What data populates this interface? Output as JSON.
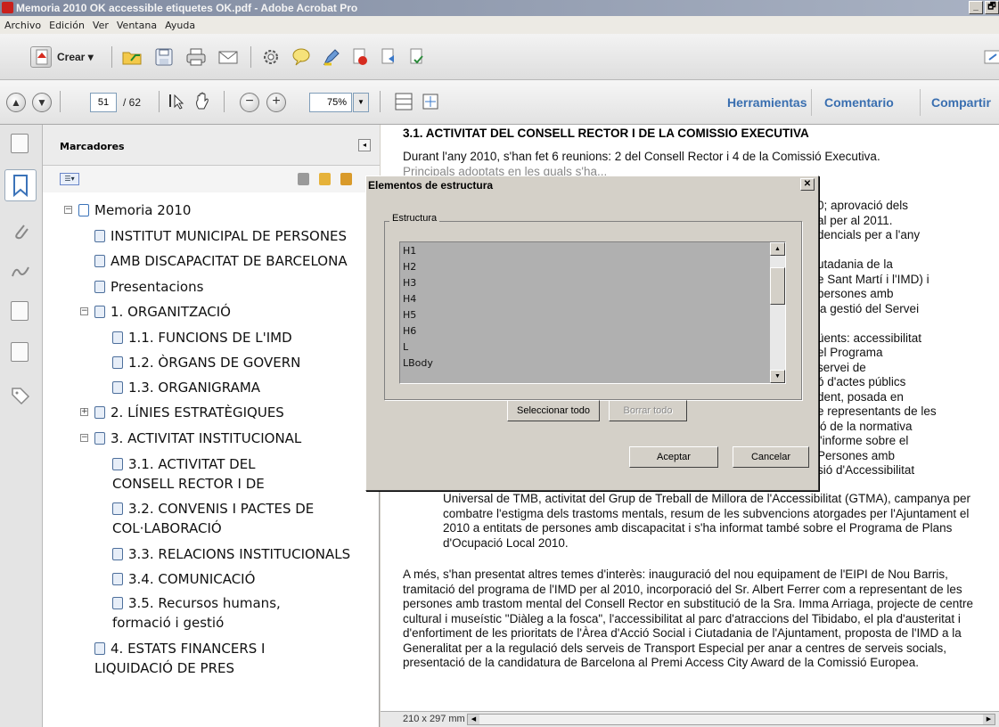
{
  "window": {
    "title": "Memoria 2010 OK accessible etiquetes OK.pdf - Adobe Acrobat Pro",
    "min_label": "_",
    "restore_label": "🗗"
  },
  "menu": [
    "Archivo",
    "Edición",
    "Ver",
    "Ventana",
    "Ayuda"
  ],
  "toolbar": {
    "create_label": "Crear ▾"
  },
  "nav": {
    "page_current": "51",
    "page_total": "/ 62",
    "zoom": "75%",
    "zoom_arrow": "▼",
    "prev_symbol": "▲",
    "next_symbol": "▼",
    "zoom_out_symbol": "−",
    "zoom_in_symbol": "+",
    "links": [
      "Herramientas",
      "Comentario",
      "Compartir"
    ]
  },
  "bookmarks": {
    "header": "Marcadores",
    "collapse_symbol": "◂",
    "options_symbol": "☰▾",
    "items": [
      {
        "label": "Memoria 2010",
        "toggle": "−"
      },
      {
        "label": "INSTITUT MUNICIPAL DE PERSONES",
        "toggle": ""
      },
      {
        "label": "AMB DISCAPACITAT DE BARCELONA",
        "toggle": ""
      },
      {
        "label": "Presentacions",
        "toggle": ""
      },
      {
        "label": "1. ORGANITZACIÓ",
        "toggle": "−"
      },
      {
        "label": "1.1. FUNCIONS DE L'IMD",
        "toggle": ""
      },
      {
        "label": "1.2. ÒRGANS DE GOVERN",
        "toggle": ""
      },
      {
        "label": "1.3. ORGANIGRAMA",
        "toggle": ""
      },
      {
        "label": "2. LÍNIES ESTRATÈGIQUES",
        "toggle": "+"
      },
      {
        "label": "3. ACTIVITAT INSTITUCIONAL",
        "toggle": "−"
      },
      {
        "label": "3.1.  ACTIVITAT DEL CONSELL RECTOR I DE",
        "toggle": ""
      },
      {
        "label": "3.2. CONVENIS I PACTES DE COL·LABORACIÓ",
        "toggle": ""
      },
      {
        "label": "3.3. RELACIONS INSTITUCIONALS",
        "toggle": ""
      },
      {
        "label": "3.4. COMUNICACIÓ",
        "toggle": ""
      },
      {
        "label": "3.5. Recursos humans, formació i gestió",
        "toggle": ""
      },
      {
        "label": "4. ESTATS FINANCERS I LIQUIDACIÓ DE PRES",
        "toggle": ""
      }
    ]
  },
  "document": {
    "heading": "3.1.  ACTIVITAT DEL CONSELL RECTOR I DE LA COMISSIO EXECUTIVA",
    "para1": "Durant l'any 2010, s'han fet 6 reunions: 2 del Consell Rector i 4 de la Comissió Executiva.",
    "para1_cut": "Principals adoptats en les quals s'ha...",
    "right_lines": [
      "0; aprovació dels",
      "al per al 2011.",
      "dencials per a l'any",
      "",
      "utadania de la",
      "e Sant Martí i l'IMD) i",
      "persones amb",
      "la gestió del Servei",
      "",
      "üents: accessibilitat",
      "el Programa",
      "servei de",
      "ó d'actes públics",
      "dent, posada en",
      "e representants de les",
      "ió de la normativa",
      "l'informe sobre el",
      "Persones amb",
      "sió d'Accessibilitat"
    ],
    "para_indented": "Universal de TMB, activitat del Grup de Treball de Millora de l'Accessibilitat (GTMA), campanya per combatre l'estigma dels trastoms mentals, resum de les subvencions atorgades per l'Ajuntament el 2010 a entitats de persones amb discapacitat i s'ha informat també sobre el Programa de Plans d'Ocupació Local 2010.",
    "para2": "A més, s'han presentat altres temes d'interès: inauguració del nou equipament de l'EIPI de Nou Barris, tramitació del programa de l'IMD per al 2010, incorporació del Sr. Albert Ferrer com a representant de les persones amb trastom mental del Consell Rector en substitució de la Sra. Imma Arriaga, projecte de centre cultural i museístic \"Diàleg a la fosca\", l'accessibilitat al parc d'atraccions del Tibidabo, el pla d'austeritat i d'enfortiment de les prioritats de l'Àrea d'Acció Social i Ciutadania de l'Ajuntament, proposta de l'IMD a la Generalitat per a la regulació dels serveis de Transport Especial per anar a centres de serveis socials, presentació de la candidatura de Barcelona al Premi Access City Award de la Comissió Europea."
  },
  "status": {
    "page_size": "210 x 297 mm",
    "scroll_left": "◀",
    "scroll_right": "▶"
  },
  "dialog": {
    "title": "Elementos de estructura",
    "close_label": "✕",
    "group_label": "Estructura",
    "list_items": [
      "H1",
      "H2",
      "H3",
      "H4",
      "H5",
      "H6",
      "L",
      "LBody"
    ],
    "scroll_up": "▲",
    "scroll_down": "▼",
    "select_all": "Seleccionar todo",
    "clear_all": "Borrar todo",
    "ok": "Aceptar",
    "cancel": "Cancelar"
  },
  "colors": {
    "accent_link": "#3a6fb0",
    "acrobat_red": "#c8201c",
    "dialog_bg": "#d4d0c8",
    "list_bg": "#b0b0b0"
  }
}
